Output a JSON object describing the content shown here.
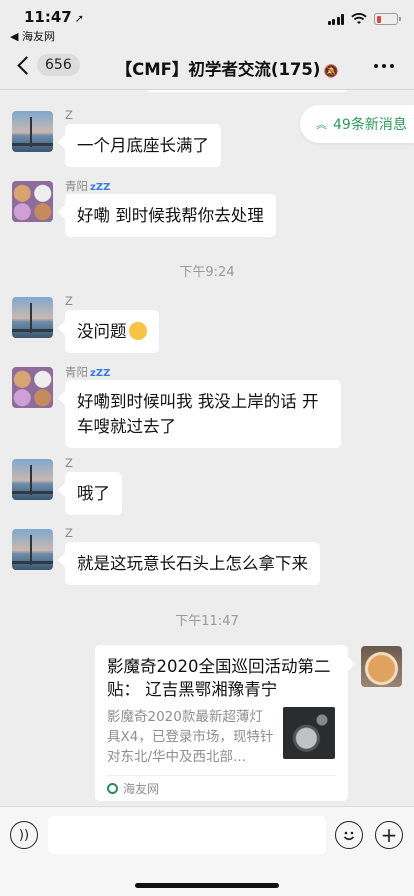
{
  "status_bar": {
    "time": "11:47",
    "location_glyph": "➚",
    "back_app": "◀ 海友网"
  },
  "nav": {
    "unread_count": "656",
    "title": "【CMF】初学者交流(175)",
    "mute_glyph": "🔕"
  },
  "new_messages_badge": {
    "label": "49条新消息",
    "chevron": "︽"
  },
  "messages": [
    {
      "sender": "Z",
      "text": "一个月底座长满了",
      "avatar": "sea-avatar"
    },
    {
      "sender": "青阳",
      "text": "好嘞 到时候我帮你去处理",
      "avatar": "cats-avatar"
    },
    {
      "sender": "Z",
      "text": "没问题",
      "avatar": "sea-avatar"
    },
    {
      "sender": "青阳",
      "text_line1": "好嘞到时候叫我 我没上岸的话 开",
      "text_line2": "车嗖就过去了",
      "avatar": "cats-avatar"
    },
    {
      "sender": "Z",
      "text": "哦了",
      "avatar": "sea-avatar"
    },
    {
      "sender": "Z",
      "text": "就是这玩意长石头上怎么拿下来",
      "avatar": "sea-avatar"
    }
  ],
  "sleep_badge": "zZZ",
  "timestamps": {
    "t1": "下午9:24",
    "t2": "下午11:47"
  },
  "link_card": {
    "title": "影魔奇2020全国巡回活动第二贴： 辽吉黑鄂湘豫青宁",
    "description": "影魔奇2020款最新超薄灯具X4，已登录市场，现特针对东北/华中及西北部...",
    "source": "海友网"
  }
}
